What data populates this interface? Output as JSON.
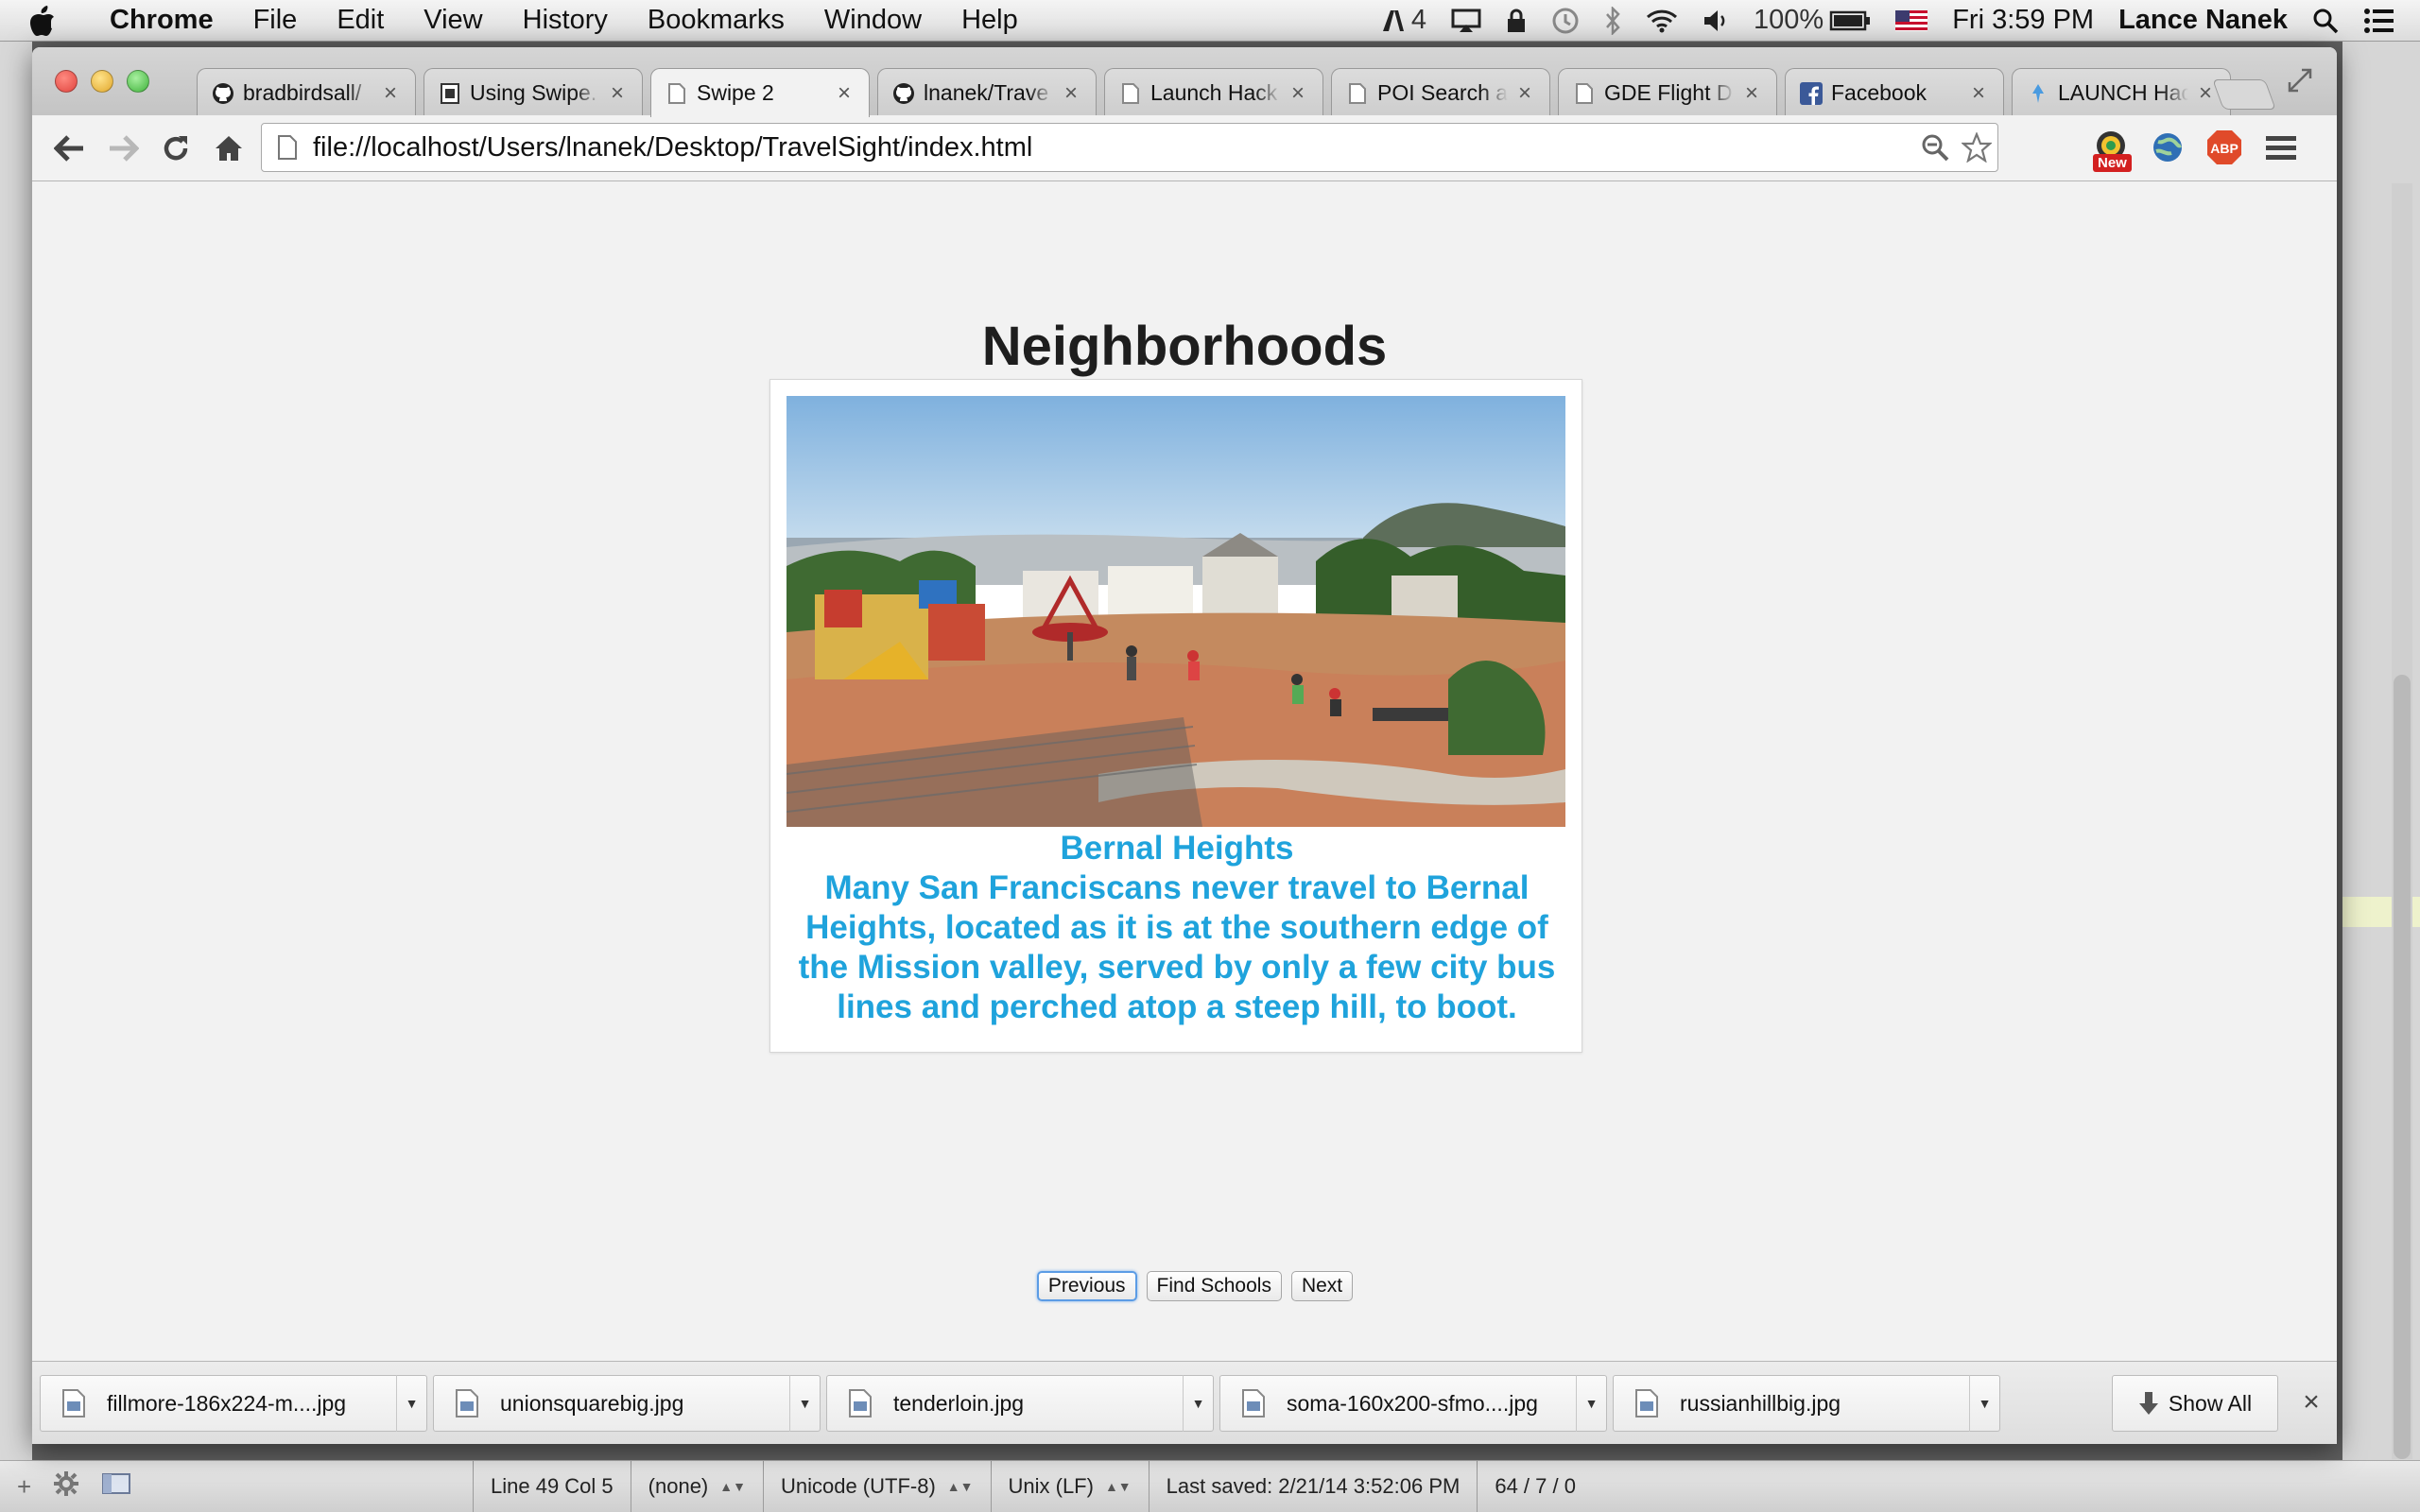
{
  "menubar": {
    "app_name": "Chrome",
    "items": [
      "File",
      "Edit",
      "View",
      "History",
      "Bookmarks",
      "Window",
      "Help"
    ],
    "status": {
      "adobe_count": "4",
      "battery": "100%",
      "clock": "Fri 3:59 PM",
      "user": "Lance Nanek"
    }
  },
  "tabs": [
    {
      "title": "bradbirdsall/",
      "favicon": "github-icon"
    },
    {
      "title": "Using Swipe.",
      "favicon": "page-icon"
    },
    {
      "title": "Swipe 2",
      "favicon": "page-icon"
    },
    {
      "title": "lnanek/Trave",
      "favicon": "github-icon"
    },
    {
      "title": "Launch Hack",
      "favicon": "page-icon"
    },
    {
      "title": "POI Search a",
      "favicon": "page-icon"
    },
    {
      "title": "GDE Flight D",
      "favicon": "page-icon"
    },
    {
      "title": "Facebook",
      "favicon": "facebook-icon"
    },
    {
      "title": "LAUNCH Hac",
      "favicon": "launch-icon"
    }
  ],
  "active_tab_index": 2,
  "toolbar": {
    "url": "file://localhost/Users/lnanek/Desktop/TravelSight/index.html",
    "ext_new_badge": "New",
    "abp_label": "ABP"
  },
  "page": {
    "title": "Neighborhoods",
    "card": {
      "name": "Bernal Heights",
      "description": "Many San Franciscans never travel to Bernal Heights, located as it is at the southern edge of the Mission valley, served by only a few city bus lines and perched atop a steep hill, to boot."
    },
    "buttons": {
      "previous": "Previous",
      "find_schools": "Find Schools",
      "next": "Next"
    },
    "caption_color": "#1fa3dc"
  },
  "downloads": {
    "items": [
      "fillmore-186x224-m....jpg",
      "unionsquarebig.jpg",
      "tenderloin.jpg",
      "soma-160x200-sfmo....jpg",
      "russianhillbig.jpg"
    ],
    "show_all": "Show All"
  },
  "editor_status": {
    "position": "Line 49 Col 5",
    "syntax": "(none)",
    "encoding": "Unicode (UTF-8)",
    "line_endings": "Unix (LF)",
    "last_saved": "Last saved: 2/21/14 3:52:06 PM",
    "counts": "64 / 7 / 0"
  }
}
